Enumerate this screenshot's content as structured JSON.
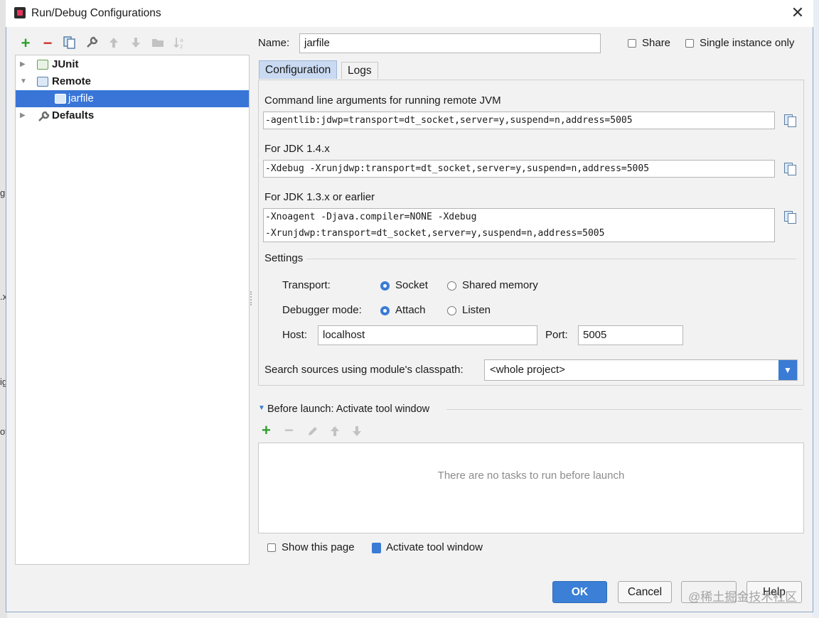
{
  "window": {
    "title": "Run/Debug Configurations",
    "close_symbol": "✕"
  },
  "background_ide": {
    "left_fragments": [
      "g",
      ".x",
      "ig",
      "ot"
    ]
  },
  "tree": {
    "items": [
      {
        "label": "JUnit",
        "expanded": false,
        "icon": "junit-icon"
      },
      {
        "label": "Remote",
        "expanded": true,
        "icon": "remote-icon"
      },
      {
        "label": "jarfile",
        "selected": true,
        "icon": "remote-config-icon"
      },
      {
        "label": "Defaults",
        "expanded": false,
        "icon": "wrench-icon"
      }
    ]
  },
  "toolbar": {
    "add": "+",
    "remove": "−"
  },
  "name": {
    "label": "Name:",
    "value": "jarfile"
  },
  "share": {
    "label": "Share",
    "checked": false
  },
  "single_instance": {
    "label": "Single instance only",
    "checked": false
  },
  "tabs": [
    {
      "label": "Configuration",
      "active": true
    },
    {
      "label": "Logs",
      "active": false
    }
  ],
  "config": {
    "cmd_label": "Command line arguments for running remote JVM",
    "cmd_value": "-agentlib:jdwp=transport=dt_socket,server=y,suspend=n,address=5005",
    "jdk14_label": "For JDK 1.4.x",
    "jdk14_value": "-Xdebug -Xrunjdwp:transport=dt_socket,server=y,suspend=n,address=5005",
    "jdk13_label": "For JDK 1.3.x or earlier",
    "jdk13_line1": "-Xnoagent -Djava.compiler=NONE -Xdebug",
    "jdk13_line2": "-Xrunjdwp:transport=dt_socket,server=y,suspend=n,address=5005",
    "settings_label": "Settings",
    "transport_label": "Transport:",
    "transport_socket": "Socket",
    "transport_shared": "Shared memory",
    "transport_selected": "Socket",
    "debugger_label": "Debugger mode:",
    "debugger_attach": "Attach",
    "debugger_listen": "Listen",
    "debugger_selected": "Attach",
    "host_label": "Host:",
    "host_value": "localhost",
    "port_label": "Port:",
    "port_value": "5005",
    "search_label": "Search sources using module's classpath:",
    "search_value": "<whole project>"
  },
  "before_launch": {
    "label": "Before launch: Activate tool window",
    "empty_text": "There are no tasks to run before launch"
  },
  "show_page": {
    "label": "Show this page",
    "checked": false
  },
  "activate_tool": {
    "label": "Activate tool window",
    "checked": true
  },
  "buttons": {
    "ok": "OK",
    "cancel": "Cancel",
    "help": "Help"
  },
  "watermark": "@稀土掘金技术社区",
  "colors": {
    "accent": "#3b7fd6",
    "selection": "#3875d7",
    "tab_active": "#c9daf2"
  }
}
